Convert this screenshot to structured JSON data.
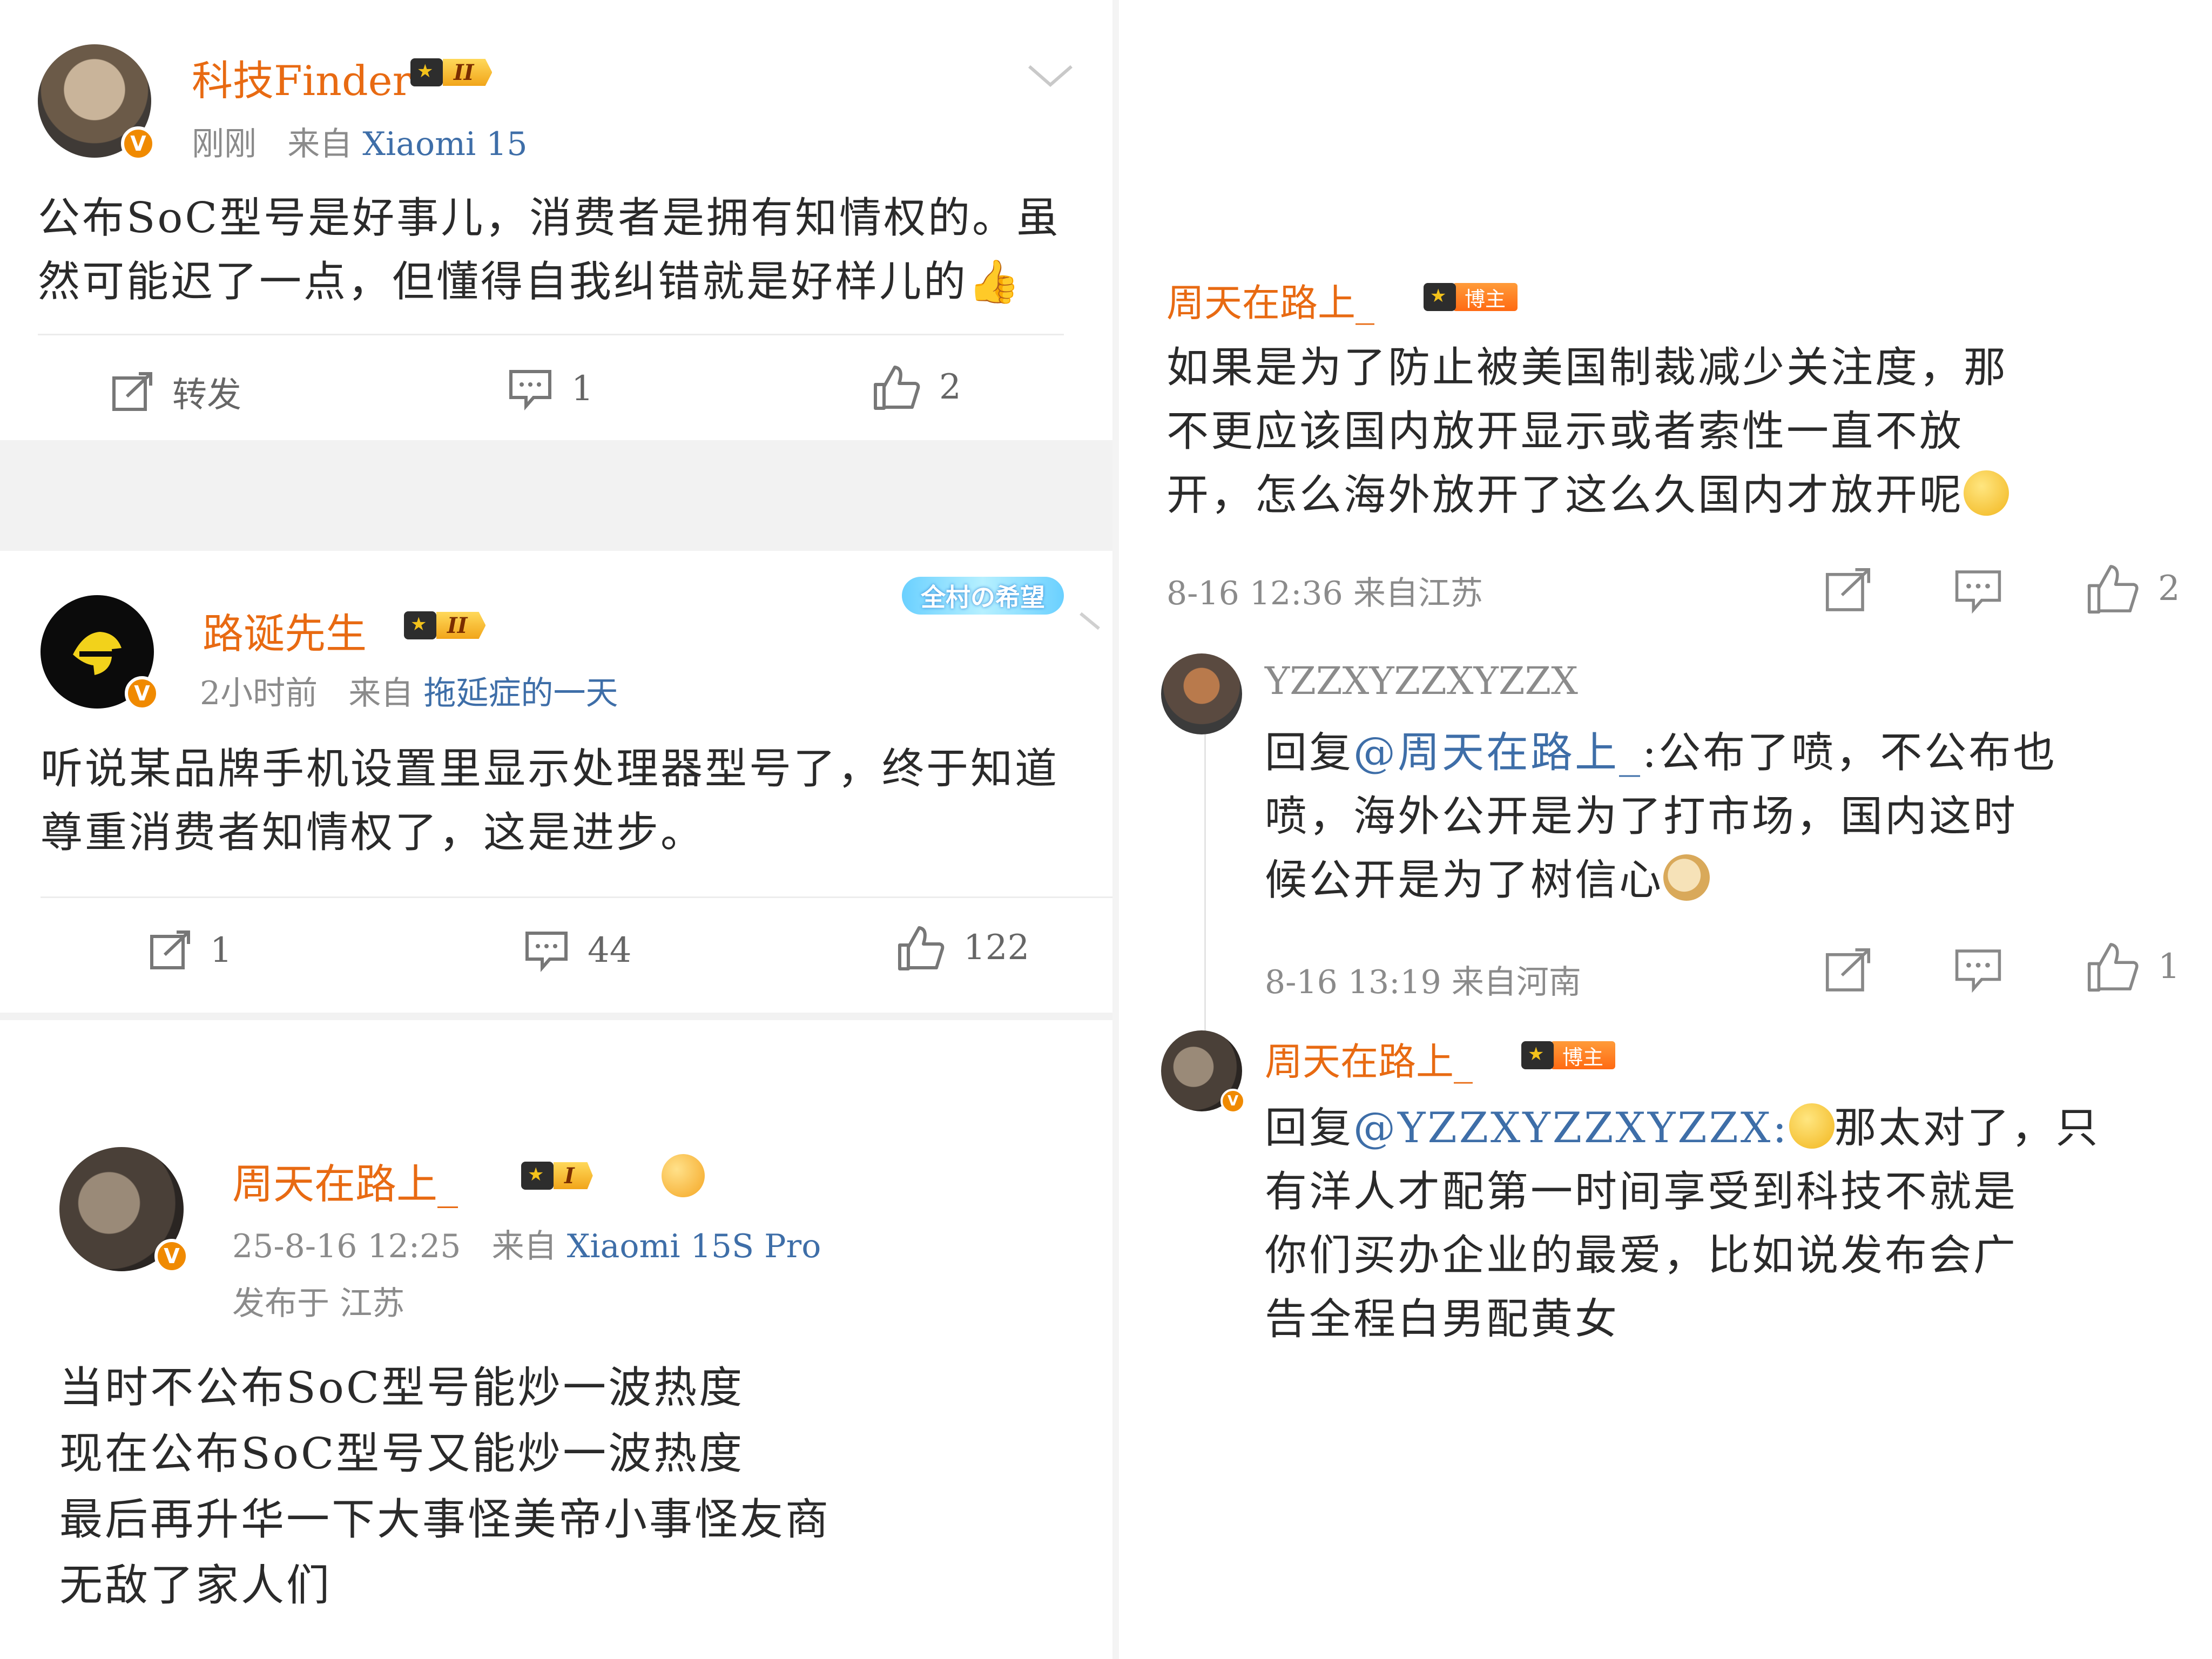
{
  "left_panel": {
    "post1": {
      "username": "科技Finder",
      "level_badge": "II",
      "time": "刚刚",
      "source_prefix": "来自",
      "source": "Xiaomi 15",
      "text_line1": "公布SoC型号是好事儿，消费者是拥有知情权的。虽",
      "text_line2": "然可能迟了一点，但懂得自我纠错就是好样儿的",
      "repost_label": "转发",
      "comment_count": "1",
      "like_count": "2"
    },
    "post2": {
      "username": "路诞先生",
      "level_badge": "II",
      "badge_sticker": "全村の希望",
      "time": "2小时前",
      "source_prefix": "来自",
      "source": "拖延症的一天",
      "text_line1": "听说某品牌手机设置里显示处理器型号了，终于知道",
      "text_line2": "尊重消费者知情权了，这是进步。",
      "repost_count": "1",
      "comment_count": "44",
      "like_count": "122"
    },
    "post3": {
      "username": "周天在路上_",
      "level_badge": "I",
      "time": "25-8-16 12:25",
      "source_prefix": "来自",
      "source": "Xiaomi 15S Pro",
      "location": "发布于 江苏",
      "text_line1": "当时不公布SoC型号能炒一波热度",
      "text_line2": "现在公布SoC型号又能炒一波热度",
      "text_line3": "最后再升华一下大事怪美帝小事怪友商",
      "text_line4": "无敌了家人们"
    }
  },
  "right_panel": {
    "comment1": {
      "username": "周天在路上_",
      "tag": "博主",
      "text_line1": "如果是为了防止被美国制裁减少关注度，那",
      "text_line2": "不更应该国内放开显示或者索性一直不放",
      "text_line3": "开，怎么海外放开了这么久国内才放开呢",
      "meta": "8-16 12:36 来自江苏",
      "like_count": "2"
    },
    "reply1": {
      "username": "YZZXYZZXYZZX",
      "prefix": "回复",
      "mention": "@周天在路上_",
      "text_after_mention": ":公布了喷，不公布也",
      "text_line2": "喷，海外公开是为了打市场，国内这时",
      "text_line3": "候公开是为了树信心",
      "meta": "8-16 13:19 来自河南",
      "like_count": "1"
    },
    "reply2": {
      "username": "周天在路上_",
      "tag": "博主",
      "prefix": "回复",
      "mention": "@YZZXYZZXYZZX",
      "text_after_mention": "那太对了，只",
      "text_line2": "有洋人才配第一时间享受到科技不就是",
      "text_line3": "你们买办企业的最爱，比如说发布会广",
      "text_line4": "告全程白男配黄女"
    }
  },
  "colors": {
    "username_orange": "#e86a12",
    "link_blue": "#3e6ea8",
    "meta_gray": "#8b8b8b",
    "verified_orange": "#f08a00"
  }
}
